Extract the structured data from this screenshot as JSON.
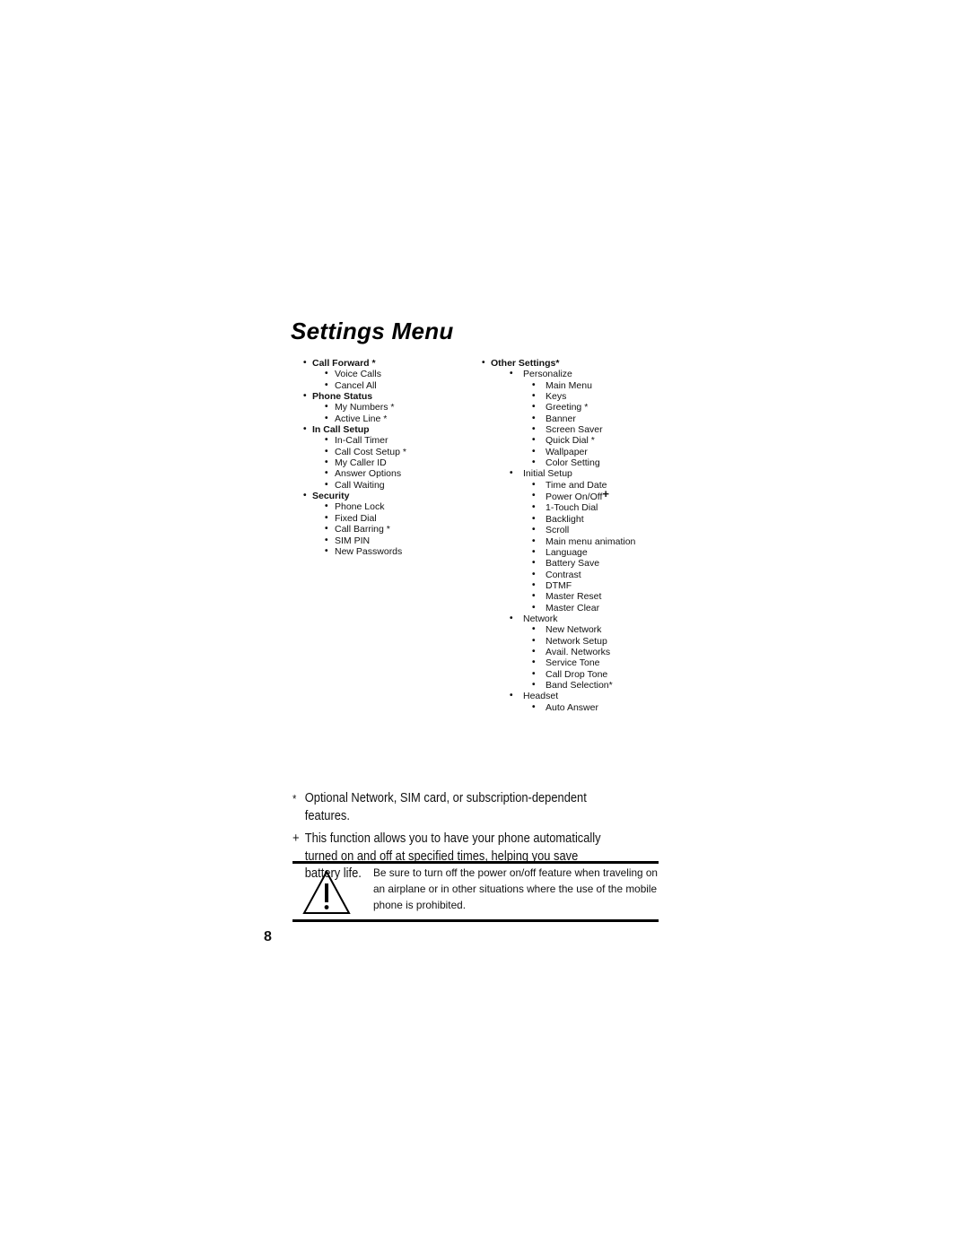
{
  "page": {
    "title": "Settings Menu",
    "page_number": "8"
  },
  "menu": {
    "left": [
      {
        "label": "Call Forward *",
        "children": [
          {
            "label": "Voice Calls"
          },
          {
            "label": "Cancel All"
          }
        ]
      },
      {
        "label": "Phone Status",
        "children": [
          {
            "label": "My Numbers *"
          },
          {
            "label": "Active Line *"
          }
        ]
      },
      {
        "label": "In Call Setup",
        "children": [
          {
            "label": "In-Call Timer"
          },
          {
            "label": "Call Cost Setup *"
          },
          {
            "label": "My Caller ID"
          },
          {
            "label": "Answer Options"
          },
          {
            "label": "Call Waiting"
          }
        ]
      },
      {
        "label": "Security",
        "children": [
          {
            "label": "Phone Lock"
          },
          {
            "label": "Fixed Dial"
          },
          {
            "label": "Call Barring *"
          },
          {
            "label": "SIM PIN"
          },
          {
            "label": "New Passwords"
          }
        ]
      }
    ],
    "right": [
      {
        "label": "Other Settings*",
        "children": [
          {
            "label": "Personalize",
            "children": [
              {
                "label": "Main Menu"
              },
              {
                "label": "Keys"
              },
              {
                "label": "Greeting *"
              },
              {
                "label": "Banner"
              },
              {
                "label": "Screen Saver"
              },
              {
                "label": "Quick Dial *"
              },
              {
                "label": "Wallpaper"
              },
              {
                "label": "Color Setting"
              }
            ]
          },
          {
            "label": "Initial Setup",
            "children": [
              {
                "label": "Time and Date"
              },
              {
                "label": "Power On/Off",
                "mark": "+"
              },
              {
                "label": "1-Touch Dial"
              },
              {
                "label": "Backlight"
              },
              {
                "label": "Scroll"
              },
              {
                "label": "Main menu animation"
              },
              {
                "label": "Language"
              },
              {
                "label": "Battery Save"
              },
              {
                "label": "Contrast"
              },
              {
                "label": "DTMF"
              },
              {
                "label": "Master Reset"
              },
              {
                "label": "Master Clear"
              }
            ]
          },
          {
            "label": "Network",
            "children": [
              {
                "label": "New Network"
              },
              {
                "label": "Network Setup"
              },
              {
                "label": "Avail. Networks"
              },
              {
                "label": "Service Tone"
              },
              {
                "label": "Call Drop Tone"
              },
              {
                "label": "Band Selection*"
              }
            ]
          },
          {
            "label": "Headset",
            "children": [
              {
                "label": "Auto Answer"
              }
            ]
          }
        ]
      }
    ]
  },
  "notes": [
    {
      "symbol": "*",
      "text": "Optional Network, SIM card, or subscription-dependent features."
    },
    {
      "symbol": "+",
      "text": "This function allows you to have your phone automatically turned on and off at specified times, helping you save battery life."
    }
  ],
  "warning": {
    "icon": "warning-triangle-icon",
    "text": "Be sure to turn off the power on/off feature when traveling on an airplane or in other situations where the use of the mobile phone is prohibited."
  },
  "bullet_glyph": "•"
}
